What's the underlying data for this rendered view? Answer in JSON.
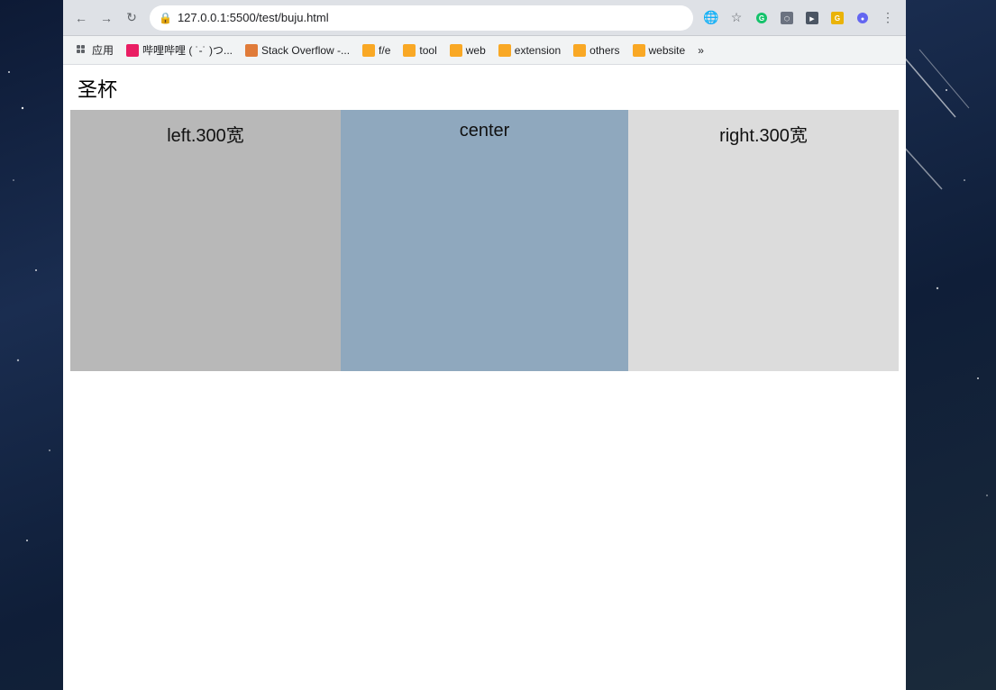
{
  "browser": {
    "url": "127.0.0.1:5500/test/buju.html",
    "nav": {
      "back": "←",
      "forward": "→",
      "reload": "↻"
    }
  },
  "bookmarks": [
    {
      "label": "应用",
      "color": "#5f6368",
      "type": "apps"
    },
    {
      "label": "哔哩哔哩 ( ˙-˙ )つ...",
      "color": "#e91e63",
      "type": "bookmark"
    },
    {
      "label": "Stack Overflow -...",
      "color": "#e07b39",
      "type": "bookmark"
    },
    {
      "label": "f/e",
      "color": "#f9a825",
      "type": "bookmark"
    },
    {
      "label": "tool",
      "color": "#f9a825",
      "type": "bookmark"
    },
    {
      "label": "web",
      "color": "#f9a825",
      "type": "bookmark"
    },
    {
      "label": "extension",
      "color": "#f9a825",
      "type": "bookmark"
    },
    {
      "label": "others",
      "color": "#f9a825",
      "type": "bookmark"
    },
    {
      "label": "website",
      "color": "#f9a825",
      "type": "bookmark"
    }
  ],
  "page": {
    "title": "圣杯",
    "columns": [
      {
        "label": "left.300宽",
        "color": "#b8b8b8"
      },
      {
        "label": "center",
        "color": "#8fa8be"
      },
      {
        "label": "right.300宽",
        "color": "#dcdcdc"
      }
    ]
  }
}
